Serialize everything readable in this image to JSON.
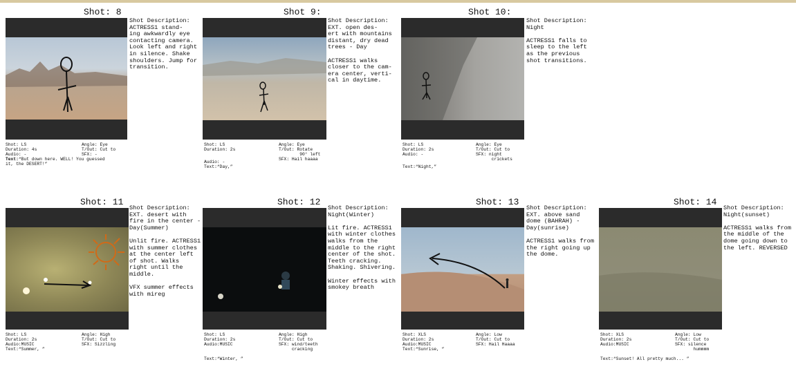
{
  "shots": [
    {
      "title": "Shot: 8",
      "description": "Shot Description:\nACTRESS1 stand-\ning awkwardly eye\ncontacting camera.\nLook left and right\nin silence. Shake\nshoulders. Jump for\ntransition.",
      "shot": "Shot: LS",
      "duration": "Duration: 4s",
      "audio": "Audio: -",
      "angle": "Angle: Eye",
      "tout": "T/Out: Cut to",
      "sfx": "SFX: -",
      "text_label": "Text:",
      "text": "“But down here. WELL! You guessed\nit, the DESERT!”"
    },
    {
      "title": "Shot 9:",
      "description": "Shot Description:\nEXT. open des-\nert with mountains\ndistant, dry dead\ntrees - Day\n\nACTRESS1 walks\ncloser to the cam-\nera center, verti-\ncal in daytime.",
      "shot": "Shot: LS",
      "duration": "Duration: 2s",
      "audio": "Audio: -",
      "angle": "Angle: Eye",
      "tout": "T/Out: Rotate\n        90° left",
      "sfx": "SFX: Hail haaaa",
      "text_label": "",
      "text": "Text:“Day,”"
    },
    {
      "title": "Shot 10:",
      "description": "Shot Description:\nNight\n\nACTRESS1 falls to\nsleep to the left\nas the previous\nshot transitions.",
      "shot": "Shot: LS",
      "duration": "Duration: 2s",
      "audio": "Audio: -",
      "angle": "Angle: Eye",
      "tout": "T/Out: Cut to",
      "sfx": "SFX: night\n      crickets",
      "text_label": "",
      "text": "Text:“Night,”"
    },
    {
      "title": "Shot: 11",
      "description": "Shot Description:\nEXT. desert with\nfire in the center -\nDay(Summer)\n\nUnlit fire. ACTRESS1\nwith summer clothes\nat the center left\nof shot. Walks\nright until the\nmiddle.\n\nVFX summer effects\nwith mireg",
      "shot": "Shot: LS",
      "duration": "Duration: 2s",
      "audio": "Audio:MUSIC",
      "angle": "Angle: High",
      "tout": "T/Out: Cut to",
      "sfx": "SFX: Sizzling",
      "text_label": "",
      "text": "Text:“Summer, ”"
    },
    {
      "title": "Shot: 12",
      "description": "Shot Description:\nNight(Winter)\n\nLit fire. ACTRESS1\nwith winter clothes\nwalks from the\nmiddle to the right\ncenter of the shot.\nTeeth cracking.\nShaking. Shivering.\n\nWinter effects with\nsmokey breath",
      "shot": "Shot: LS",
      "duration": "Duration: 2s",
      "audio": "Audio:MUSIC",
      "angle": "Angle: High",
      "tout": "T/Out: Cut to",
      "sfx": "SFX: wind/teeth\n     cracking",
      "text_label": "",
      "text": "Text:“Winter, ”"
    },
    {
      "title": "Shot: 13",
      "description": "Shot Description:\nEXT. above sand\ndome (BAHRAH) -\nDay(sunrise)\n\nACTRESS1 walks from\nthe right going up\nthe dome.",
      "shot": "Shot: XLS",
      "duration": "Duration: 2s",
      "audio": "Audio:MUSIC",
      "angle": "Angle: Low",
      "tout": "T/Out: Cut to",
      "sfx": "SFX: Hail Haaaa",
      "text_label": "",
      "text": "Text:“Sunrise, ”"
    },
    {
      "title": "Shot: 14",
      "description": "Shot Description:\nNight(sunset)\n\nACTRESS1 walks from\nthe middle of the\ndome going down to\nthe left. REVERSED",
      "shot": "Shot: XLS",
      "duration": "Duration: 2s",
      "audio": "Audio:MUSIC",
      "angle": "Angle: Low",
      "tout": "T/Out: Cut to",
      "sfx": "SFX: silence\n       hummmm",
      "text_label": "",
      "text": "Text:“Sunset! All pretty much... ”"
    }
  ]
}
